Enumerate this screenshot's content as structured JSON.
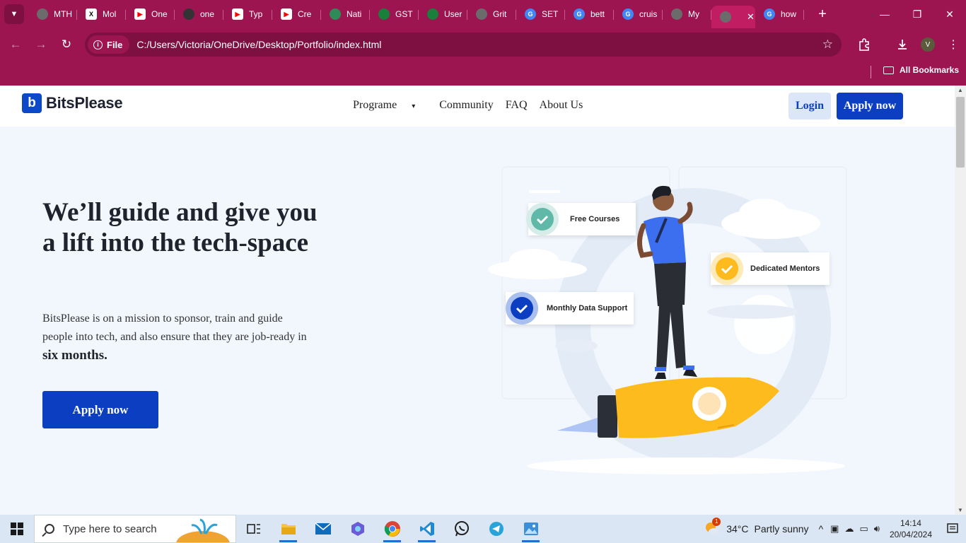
{
  "browser": {
    "tabs": [
      {
        "label": "MTH",
        "icon": "globe-icon",
        "color": "#6b6b6b"
      },
      {
        "label": "Mol",
        "icon": "x-icon",
        "color": "#000000"
      },
      {
        "label": "One",
        "icon": "youtube-icon",
        "color": "#ff0000"
      },
      {
        "label": "one",
        "icon": "github-icon",
        "color": "#333333"
      },
      {
        "label": "Typ",
        "icon": "youtube-icon",
        "color": "#ff0000"
      },
      {
        "label": "Cre",
        "icon": "youtube-icon",
        "color": "#ff0000"
      },
      {
        "label": "Nati",
        "icon": "nigeria-seal-icon",
        "color": "#2e8b57"
      },
      {
        "label": "GST",
        "icon": "gst-icon",
        "color": "#1a7f3b"
      },
      {
        "label": "User",
        "icon": "gst-icon",
        "color": "#1a7f3b"
      },
      {
        "label": "Grit",
        "icon": "globe-icon",
        "color": "#6b6b6b"
      },
      {
        "label": "SET",
        "icon": "google-icon",
        "color": "#4285f4"
      },
      {
        "label": "bett",
        "icon": "google-icon",
        "color": "#4285f4"
      },
      {
        "label": "cruis",
        "icon": "google-icon",
        "color": "#4285f4"
      },
      {
        "label": "My",
        "icon": "globe-icon",
        "color": "#6b6b6b"
      },
      {
        "label": "",
        "icon": "globe-icon",
        "color": "#6b6b6b",
        "active": true
      },
      {
        "label": "how",
        "icon": "google-icon",
        "color": "#4285f4"
      }
    ],
    "address_chip": "File",
    "url": "C:/Users/Victoria/OneDrive/Desktop/Portfolio/index.html",
    "profile_initial": "V",
    "bookmarks_label": "All Bookmarks"
  },
  "site": {
    "brand": "BitsPlease",
    "nav": {
      "programe": "Programe",
      "community": "Community",
      "faq": "FAQ",
      "about": "About Us"
    },
    "login": "Login",
    "apply_top": "Apply now",
    "hero": {
      "title": "We’ll guide and give you a lift into the tech-space",
      "text_before": "BitsPlease is on a mission to sponsor, train and guide people into tech, and also ensure that they are job-ready in ",
      "text_bold": "six months.",
      "cta": "Apply now"
    },
    "badges": {
      "free_courses": "Free Courses",
      "dedicated_mentors": "Dedicated Mentors",
      "monthly_data": "Monthly Data Support"
    },
    "colors": {
      "primary": "#0b3ec0",
      "accent_yellow": "#fdbb1e",
      "teal": "#5fb8a8",
      "page_bg": "#f2f7fd"
    }
  },
  "taskbar": {
    "search_placeholder": "Type here to search",
    "weather_temp": "34°C",
    "weather_desc": "Partly sunny",
    "weather_badge": "1",
    "time": "14:14",
    "date": "20/04/2024"
  }
}
